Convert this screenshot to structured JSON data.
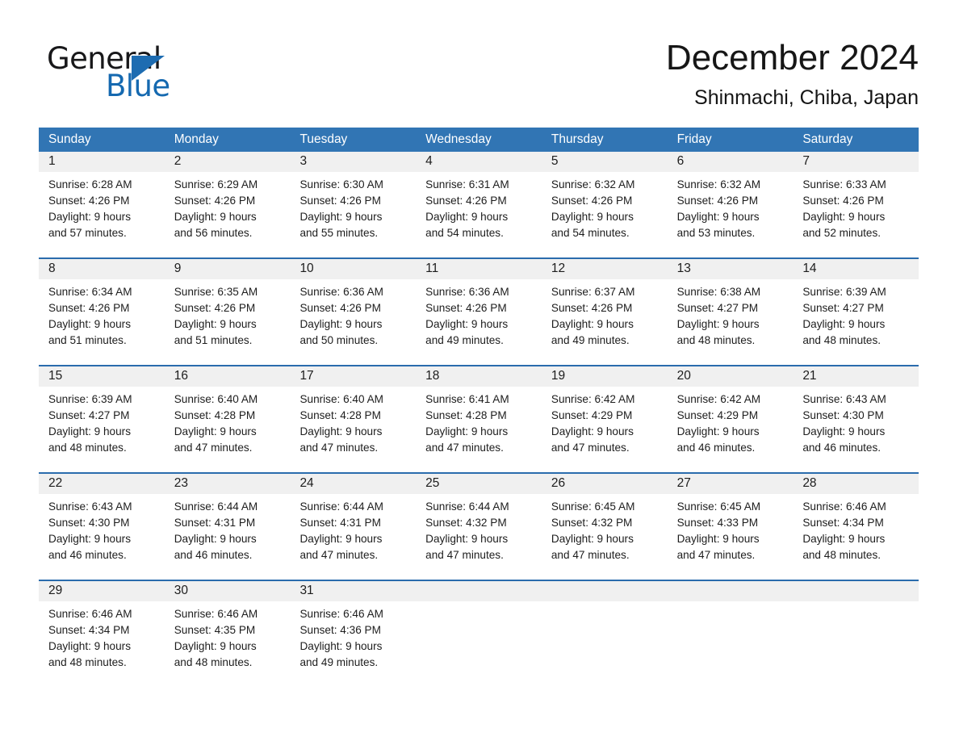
{
  "brand": {
    "name_part1": "General",
    "name_part2": "Blue",
    "accent_color": "#1569b0",
    "triangle_color": "#1d6cb1"
  },
  "header": {
    "month_title": "December 2024",
    "location": "Shinmachi, Chiba, Japan"
  },
  "calendar": {
    "header_bg": "#3175b4",
    "row_divider": "#2a6cad",
    "date_band_bg": "#f0f0f0",
    "weekdays": [
      "Sunday",
      "Monday",
      "Tuesday",
      "Wednesday",
      "Thursday",
      "Friday",
      "Saturday"
    ],
    "weeks": [
      [
        {
          "day": "1",
          "detail": "Sunrise: 6:28 AM\nSunset: 4:26 PM\nDaylight: 9 hours\nand 57 minutes."
        },
        {
          "day": "2",
          "detail": "Sunrise: 6:29 AM\nSunset: 4:26 PM\nDaylight: 9 hours\nand 56 minutes."
        },
        {
          "day": "3",
          "detail": "Sunrise: 6:30 AM\nSunset: 4:26 PM\nDaylight: 9 hours\nand 55 minutes."
        },
        {
          "day": "4",
          "detail": "Sunrise: 6:31 AM\nSunset: 4:26 PM\nDaylight: 9 hours\nand 54 minutes."
        },
        {
          "day": "5",
          "detail": "Sunrise: 6:32 AM\nSunset: 4:26 PM\nDaylight: 9 hours\nand 54 minutes."
        },
        {
          "day": "6",
          "detail": "Sunrise: 6:32 AM\nSunset: 4:26 PM\nDaylight: 9 hours\nand 53 minutes."
        },
        {
          "day": "7",
          "detail": "Sunrise: 6:33 AM\nSunset: 4:26 PM\nDaylight: 9 hours\nand 52 minutes."
        }
      ],
      [
        {
          "day": "8",
          "detail": "Sunrise: 6:34 AM\nSunset: 4:26 PM\nDaylight: 9 hours\nand 51 minutes."
        },
        {
          "day": "9",
          "detail": "Sunrise: 6:35 AM\nSunset: 4:26 PM\nDaylight: 9 hours\nand 51 minutes."
        },
        {
          "day": "10",
          "detail": "Sunrise: 6:36 AM\nSunset: 4:26 PM\nDaylight: 9 hours\nand 50 minutes."
        },
        {
          "day": "11",
          "detail": "Sunrise: 6:36 AM\nSunset: 4:26 PM\nDaylight: 9 hours\nand 49 minutes."
        },
        {
          "day": "12",
          "detail": "Sunrise: 6:37 AM\nSunset: 4:26 PM\nDaylight: 9 hours\nand 49 minutes."
        },
        {
          "day": "13",
          "detail": "Sunrise: 6:38 AM\nSunset: 4:27 PM\nDaylight: 9 hours\nand 48 minutes."
        },
        {
          "day": "14",
          "detail": "Sunrise: 6:39 AM\nSunset: 4:27 PM\nDaylight: 9 hours\nand 48 minutes."
        }
      ],
      [
        {
          "day": "15",
          "detail": "Sunrise: 6:39 AM\nSunset: 4:27 PM\nDaylight: 9 hours\nand 48 minutes."
        },
        {
          "day": "16",
          "detail": "Sunrise: 6:40 AM\nSunset: 4:28 PM\nDaylight: 9 hours\nand 47 minutes."
        },
        {
          "day": "17",
          "detail": "Sunrise: 6:40 AM\nSunset: 4:28 PM\nDaylight: 9 hours\nand 47 minutes."
        },
        {
          "day": "18",
          "detail": "Sunrise: 6:41 AM\nSunset: 4:28 PM\nDaylight: 9 hours\nand 47 minutes."
        },
        {
          "day": "19",
          "detail": "Sunrise: 6:42 AM\nSunset: 4:29 PM\nDaylight: 9 hours\nand 47 minutes."
        },
        {
          "day": "20",
          "detail": "Sunrise: 6:42 AM\nSunset: 4:29 PM\nDaylight: 9 hours\nand 46 minutes."
        },
        {
          "day": "21",
          "detail": "Sunrise: 6:43 AM\nSunset: 4:30 PM\nDaylight: 9 hours\nand 46 minutes."
        }
      ],
      [
        {
          "day": "22",
          "detail": "Sunrise: 6:43 AM\nSunset: 4:30 PM\nDaylight: 9 hours\nand 46 minutes."
        },
        {
          "day": "23",
          "detail": "Sunrise: 6:44 AM\nSunset: 4:31 PM\nDaylight: 9 hours\nand 46 minutes."
        },
        {
          "day": "24",
          "detail": "Sunrise: 6:44 AM\nSunset: 4:31 PM\nDaylight: 9 hours\nand 47 minutes."
        },
        {
          "day": "25",
          "detail": "Sunrise: 6:44 AM\nSunset: 4:32 PM\nDaylight: 9 hours\nand 47 minutes."
        },
        {
          "day": "26",
          "detail": "Sunrise: 6:45 AM\nSunset: 4:32 PM\nDaylight: 9 hours\nand 47 minutes."
        },
        {
          "day": "27",
          "detail": "Sunrise: 6:45 AM\nSunset: 4:33 PM\nDaylight: 9 hours\nand 47 minutes."
        },
        {
          "day": "28",
          "detail": "Sunrise: 6:46 AM\nSunset: 4:34 PM\nDaylight: 9 hours\nand 48 minutes."
        }
      ],
      [
        {
          "day": "29",
          "detail": "Sunrise: 6:46 AM\nSunset: 4:34 PM\nDaylight: 9 hours\nand 48 minutes."
        },
        {
          "day": "30",
          "detail": "Sunrise: 6:46 AM\nSunset: 4:35 PM\nDaylight: 9 hours\nand 48 minutes."
        },
        {
          "day": "31",
          "detail": "Sunrise: 6:46 AM\nSunset: 4:36 PM\nDaylight: 9 hours\nand 49 minutes."
        },
        {
          "day": "",
          "detail": ""
        },
        {
          "day": "",
          "detail": ""
        },
        {
          "day": "",
          "detail": ""
        },
        {
          "day": "",
          "detail": ""
        }
      ]
    ]
  }
}
